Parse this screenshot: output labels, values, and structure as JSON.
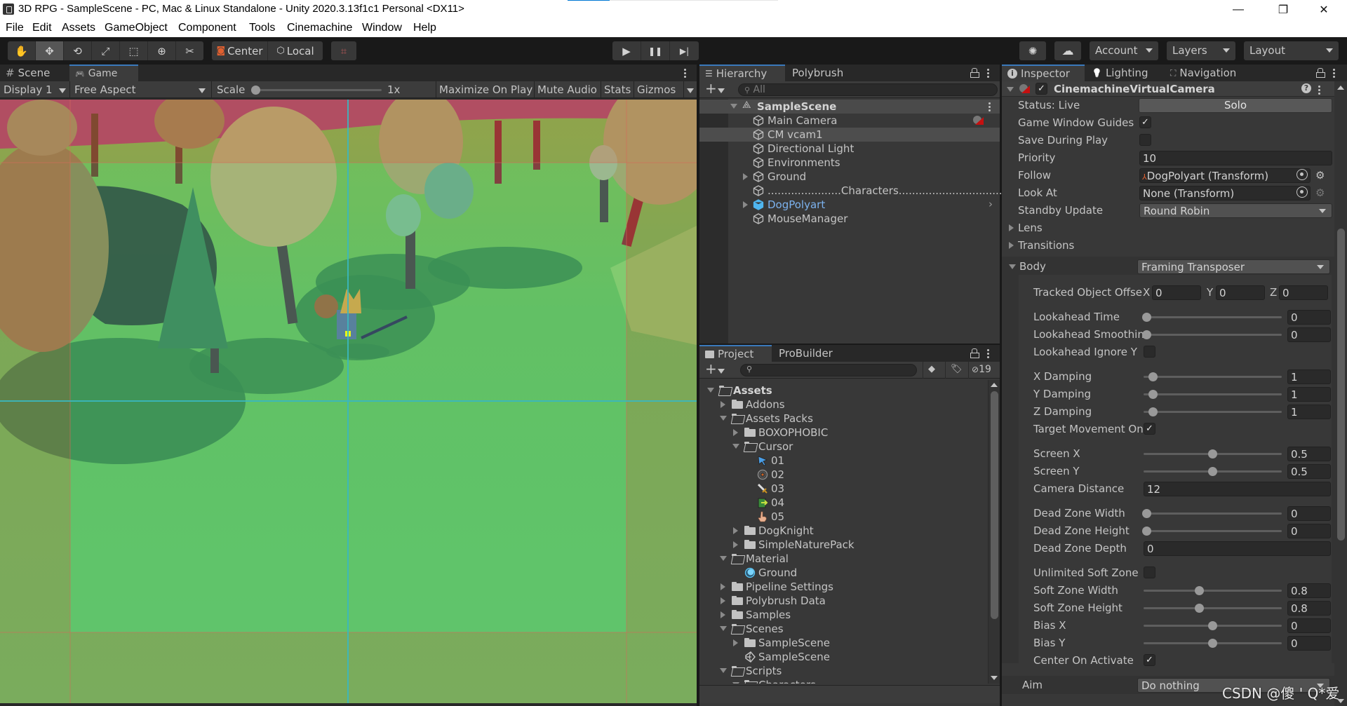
{
  "window": {
    "title": "3D RPG - SampleScene - PC, Mac & Linux Standalone - Unity 2020.3.13f1c1 Personal <DX11>",
    "minimize": "—",
    "maximize": "❐",
    "close": "✕",
    "progress_fraction": 0.2
  },
  "menu": [
    "File",
    "Edit",
    "Assets",
    "GameObject",
    "Component",
    "Tools",
    "Cinemachine",
    "Window",
    "Help"
  ],
  "toolbar": {
    "tools": [
      {
        "name": "hand-tool-icon",
        "glyph": "✋",
        "active": false
      },
      {
        "name": "move-tool-icon",
        "glyph": "✥",
        "active": true
      },
      {
        "name": "rotate-tool-icon",
        "glyph": "⟲",
        "active": false
      },
      {
        "name": "scale-tool-icon",
        "glyph": "⤢",
        "active": false
      },
      {
        "name": "rect-tool-icon",
        "glyph": "⬚",
        "active": false
      },
      {
        "name": "transform-tool-icon",
        "glyph": "⊕",
        "active": false
      },
      {
        "name": "custom-tool-icon",
        "glyph": "✂",
        "active": false
      }
    ],
    "pivot_label": "Center",
    "space_label": "Local",
    "snap_glyph": "⌗",
    "play_glyph": "▶",
    "pause_glyph": "❚❚",
    "step_glyph": "▶|",
    "services_glyph": "✺",
    "cloud_glyph": "☁",
    "account_label": "Account",
    "layers_label": "Layers",
    "layout_label": "Layout"
  },
  "scene_panel": {
    "tabs": [
      {
        "label": "Scene",
        "icon": "#",
        "active": false
      },
      {
        "label": "Game",
        "icon": "🎮",
        "active": true
      }
    ],
    "display": "Display 1",
    "aspect": "Free Aspect",
    "scale_label": "Scale",
    "scale_value": "1x",
    "scale_fraction": 0,
    "buttons": [
      "Maximize On Play",
      "Mute Audio",
      "Stats",
      "Gizmos"
    ],
    "guide_colors": {
      "dead_zone": "#5ec85f",
      "soft_zone": "#4bb5b3",
      "hard_zone": "#d94848",
      "target": "#ffff00"
    }
  },
  "hierarchy": {
    "tabs": [
      {
        "label": "Hierarchy",
        "active": true
      },
      {
        "label": "Polybrush",
        "active": false
      }
    ],
    "search_placeholder": "All",
    "scene": "SampleScene",
    "items": [
      {
        "label": "Main Camera",
        "indent": 1,
        "expandable": false,
        "selected": false,
        "highlight": false,
        "badge": "cinemachine-brain-icon"
      },
      {
        "label": "CM vcam1",
        "indent": 1,
        "expandable": false,
        "selected": true,
        "highlight": false
      },
      {
        "label": "Directional Light",
        "indent": 1,
        "expandable": false,
        "selected": false,
        "highlight": false
      },
      {
        "label": "Environments",
        "indent": 1,
        "expandable": false,
        "selected": false,
        "highlight": false
      },
      {
        "label": "Ground",
        "indent": 1,
        "expandable": true,
        "selected": false,
        "highlight": false
      },
      {
        "label": "......................Characters...................................",
        "indent": 1,
        "expandable": false,
        "selected": false,
        "highlight": false
      },
      {
        "label": "DogPolyart",
        "indent": 1,
        "expandable": true,
        "selected": false,
        "highlight": true,
        "has_child_arrow": true
      },
      {
        "label": "MouseManager",
        "indent": 1,
        "expandable": false,
        "selected": false,
        "highlight": false
      }
    ]
  },
  "project": {
    "tabs": [
      {
        "label": "Project",
        "active": true
      },
      {
        "label": "ProBuilder",
        "active": false
      }
    ],
    "search_placeholder": "",
    "hidden_count": "19",
    "tree": [
      {
        "label": "Assets",
        "depth": 0,
        "state": "open",
        "type": "folder",
        "bold": true
      },
      {
        "label": "Addons",
        "depth": 1,
        "state": "closed",
        "type": "folder"
      },
      {
        "label": "Assets Packs",
        "depth": 1,
        "state": "open",
        "type": "folder"
      },
      {
        "label": "BOXOPHOBIC",
        "depth": 2,
        "state": "closed",
        "type": "folder"
      },
      {
        "label": "Cursor",
        "depth": 2,
        "state": "open",
        "type": "folder"
      },
      {
        "label": "01",
        "depth": 3,
        "state": "leaf",
        "type": "cursor-arrow"
      },
      {
        "label": "02",
        "depth": 3,
        "state": "leaf",
        "type": "cursor-target"
      },
      {
        "label": "03",
        "depth": 3,
        "state": "leaf",
        "type": "cursor-sword"
      },
      {
        "label": "04",
        "depth": 3,
        "state": "leaf",
        "type": "cursor-door"
      },
      {
        "label": "05",
        "depth": 3,
        "state": "leaf",
        "type": "cursor-hand"
      },
      {
        "label": "DogKnight",
        "depth": 2,
        "state": "closed",
        "type": "folder"
      },
      {
        "label": "SimpleNaturePack",
        "depth": 2,
        "state": "closed",
        "type": "folder"
      },
      {
        "label": "Material",
        "depth": 1,
        "state": "open",
        "type": "folder"
      },
      {
        "label": "Ground",
        "depth": 2,
        "state": "leaf",
        "type": "material"
      },
      {
        "label": "Pipeline Settings",
        "depth": 1,
        "state": "closed",
        "type": "folder"
      },
      {
        "label": "Polybrush Data",
        "depth": 1,
        "state": "closed",
        "type": "folder"
      },
      {
        "label": "Samples",
        "depth": 1,
        "state": "closed",
        "type": "folder"
      },
      {
        "label": "Scenes",
        "depth": 1,
        "state": "open",
        "type": "folder"
      },
      {
        "label": "SampleScene",
        "depth": 2,
        "state": "closed",
        "type": "folder"
      },
      {
        "label": "SampleScene",
        "depth": 2,
        "state": "leaf",
        "type": "scene"
      },
      {
        "label": "Scripts",
        "depth": 1,
        "state": "open",
        "type": "folder"
      },
      {
        "label": "Characters",
        "depth": 2,
        "state": "open",
        "type": "folder"
      }
    ]
  },
  "inspector": {
    "tabs": [
      {
        "label": "Inspector",
        "icon": "ℹ",
        "active": true
      },
      {
        "label": "Lighting",
        "icon": "💡",
        "active": false
      },
      {
        "label": "Navigation",
        "icon": "⛶",
        "active": false
      }
    ],
    "component": {
      "name": "CinemachineVirtualCamera",
      "enabled": true
    },
    "status_label": "Status: Live",
    "solo_label": "Solo",
    "fields": {
      "game_window_guides": {
        "label": "Game Window Guides",
        "checked": true
      },
      "save_during_play": {
        "label": "Save During Play",
        "checked": false
      },
      "priority": {
        "label": "Priority",
        "value": "10"
      },
      "follow": {
        "label": "Follow",
        "value": "DogPolyart (Transform)"
      },
      "look_at": {
        "label": "Look At",
        "value": "None (Transform)"
      },
      "standby_update": {
        "label": "Standby Update",
        "value": "Round Robin"
      }
    },
    "lens_label": "Lens",
    "transitions_label": "Transitions",
    "body": {
      "label": "Body",
      "value": "Framing Transposer",
      "tracked_offset": {
        "label": "Tracked Object Offse",
        "x": "0",
        "y": "0",
        "z": "0"
      },
      "sliders_a": [
        {
          "label": "Lookahead Time",
          "value": "0",
          "fraction": 0
        },
        {
          "label": "Lookahead Smoothin",
          "value": "0",
          "fraction": 0
        }
      ],
      "lookahead_ignore_y": {
        "label": "Lookahead Ignore Y",
        "checked": false
      },
      "sliders_b": [
        {
          "label": "X Damping",
          "value": "1",
          "fraction": 0.05
        },
        {
          "label": "Y Damping",
          "value": "1",
          "fraction": 0.05
        },
        {
          "label": "Z Damping",
          "value": "1",
          "fraction": 0.05
        }
      ],
      "target_movement_only": {
        "label": "Target Movement On",
        "checked": true
      },
      "sliders_c": [
        {
          "label": "Screen X",
          "value": "0.5",
          "fraction": 0.5
        },
        {
          "label": "Screen Y",
          "value": "0.5",
          "fraction": 0.5
        }
      ],
      "camera_distance": {
        "label": "Camera Distance",
        "value": "12"
      },
      "sliders_d": [
        {
          "label": "Dead Zone Width",
          "value": "0",
          "fraction": 0
        },
        {
          "label": "Dead Zone Height",
          "value": "0",
          "fraction": 0
        }
      ],
      "dead_zone_depth": {
        "label": "Dead Zone Depth",
        "value": "0"
      },
      "unlimited_soft_zone": {
        "label": "Unlimited Soft Zone",
        "checked": false
      },
      "sliders_e": [
        {
          "label": "Soft Zone Width",
          "value": "0.8",
          "fraction": 0.4
        },
        {
          "label": "Soft Zone Height",
          "value": "0.8",
          "fraction": 0.4
        },
        {
          "label": "Bias X",
          "value": "0",
          "fraction": 0.5
        },
        {
          "label": "Bias Y",
          "value": "0",
          "fraction": 0.5
        }
      ],
      "center_on_activate": {
        "label": "Center On Activate",
        "checked": true
      }
    },
    "aim": {
      "label": "Aim",
      "value": "Do nothing"
    }
  },
  "watermark": "CSDN @傻 ' Q*爱"
}
